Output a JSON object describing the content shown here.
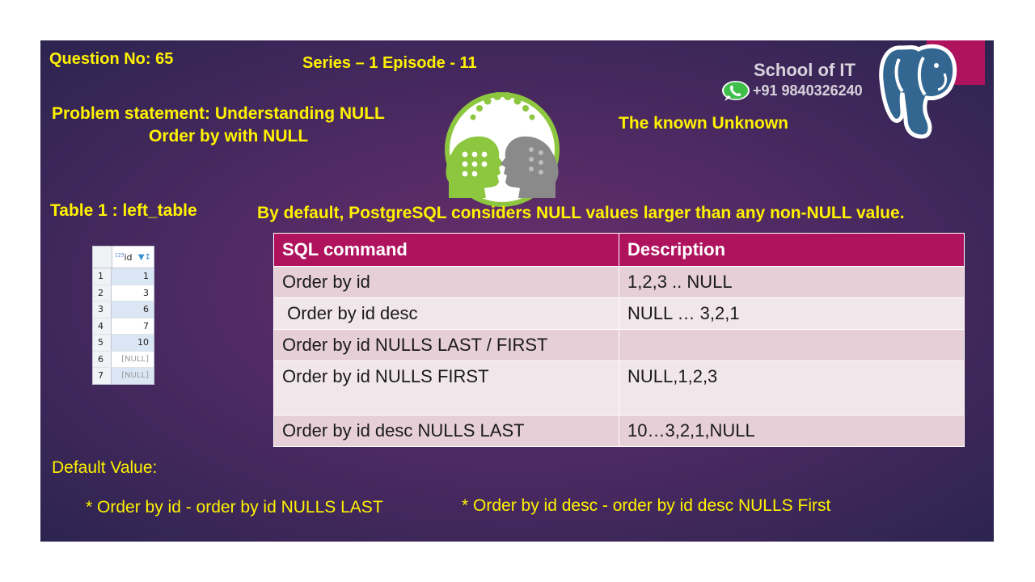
{
  "header": {
    "question": "Question No: 65",
    "series": "Series – 1  Episode - 11",
    "problem_line1": "Problem statement:  Understanding NULL",
    "problem_line2": "Order by with NULL",
    "tagline": "The known Unknown",
    "school": "School of IT",
    "phone": "+91 9840326240"
  },
  "left_table": {
    "title": "Table 1 : left_table",
    "column_type_badge": "123",
    "column": "id",
    "rows": [
      {
        "n": "1",
        "v": "1"
      },
      {
        "n": "2",
        "v": "3"
      },
      {
        "n": "3",
        "v": "6"
      },
      {
        "n": "4",
        "v": "7"
      },
      {
        "n": "5",
        "v": "10"
      },
      {
        "n": "6",
        "v": "[NULL]"
      },
      {
        "n": "7",
        "v": "[NULL]"
      }
    ]
  },
  "statement": "By default, PostgreSQL considers NULL values larger than any non-NULL value.",
  "sql_table": {
    "headers": [
      "SQL command",
      "Description"
    ],
    "rows": [
      [
        "Order by id",
        "1,2,3 .. NULL"
      ],
      [
        " Order by id desc",
        "NULL … 3,2,1"
      ],
      [
        "Order by id NULLS LAST / FIRST",
        ""
      ],
      [
        "Order by id NULLS FIRST",
        "NULL,1,2,3"
      ],
      [
        "Order by id desc NULLS LAST",
        "10…3,2,1,NULL"
      ]
    ]
  },
  "defaults": {
    "title": "Default Value:",
    "item1": "* Order by id  - order by id NULLS LAST",
    "item2": "* Order by id desc - order by id desc NULLS First"
  },
  "colors": {
    "accent": "#b0135e",
    "highlight_text": "#fff200",
    "logo_green": "#8dc63f",
    "logo_gray": "#8a8a8a",
    "postgres_blue": "#336791"
  },
  "icons": [
    "whatsapp-icon",
    "school-logo-heads",
    "postgresql-elephant-logo"
  ]
}
